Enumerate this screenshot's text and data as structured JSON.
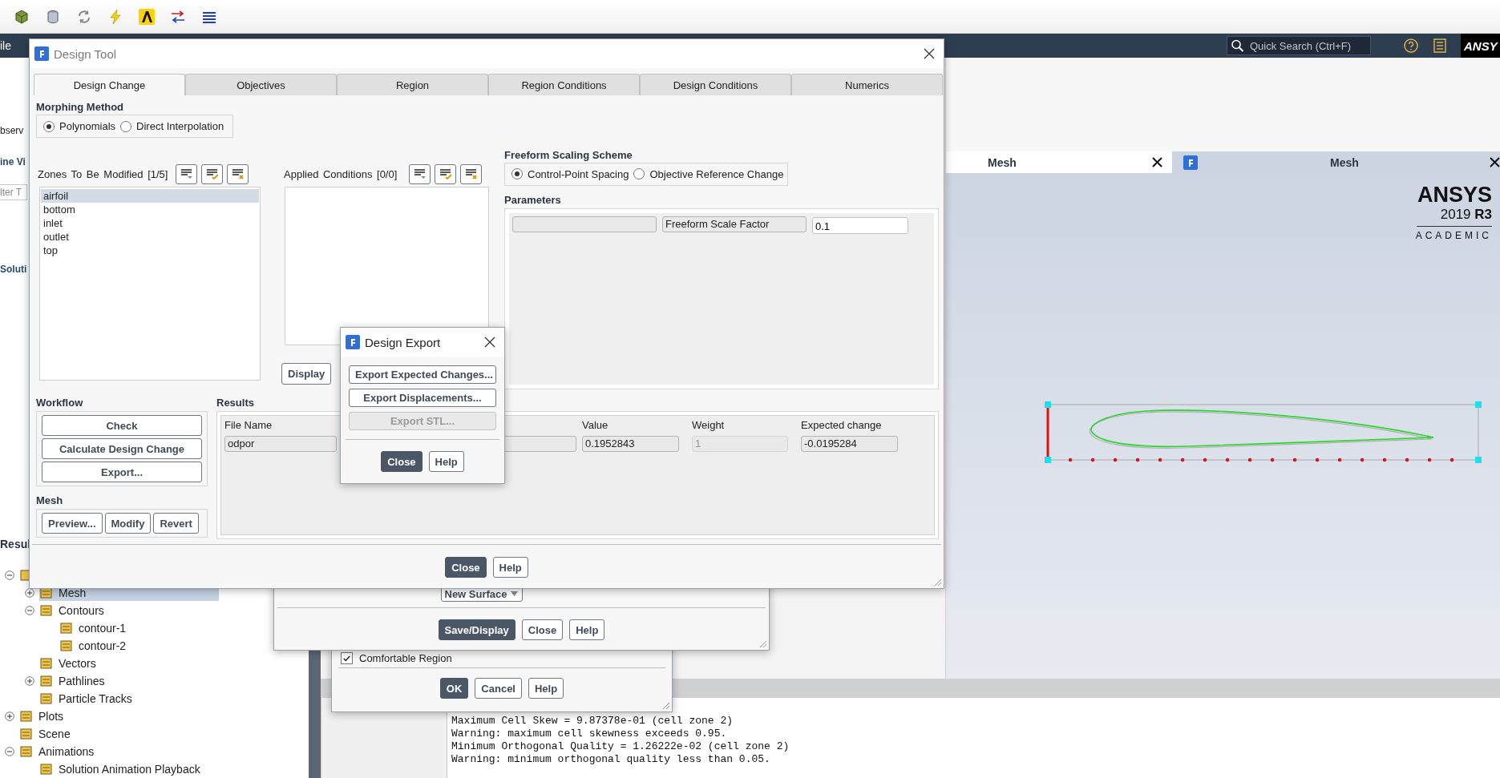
{
  "menu_bar": {
    "file_menu": "ile",
    "search": {
      "placeholder": "Quick Search (Ctrl+F)"
    },
    "logo": "ANSY"
  },
  "tree_panel": {
    "fragments": [
      {
        "kind": "label",
        "text": "bserv"
      },
      {
        "kind": "heading",
        "text": "ine Vi"
      },
      {
        "kind": "field",
        "placeholder": "lter T"
      },
      {
        "kind": "heading",
        "text": "Soluti"
      }
    ],
    "results_heading": "Resul",
    "tree": [
      {
        "expanded": true,
        "children": [
          {
            "label": "Mesh",
            "selected": true,
            "expanded": false
          },
          {
            "label": "Contours",
            "selected": false,
            "expanded": true,
            "children": [
              {
                "label": "contour-1",
                "selected": false
              },
              {
                "label": "contour-2",
                "selected": false
              }
            ]
          },
          {
            "label": "Vectors",
            "selected": false
          },
          {
            "label": "Pathlines",
            "selected": false,
            "expanded": false
          },
          {
            "label": "Particle Tracks",
            "selected": false
          }
        ]
      },
      {
        "label": "Plots",
        "selected": false,
        "expanded": false
      },
      {
        "label": "Scene",
        "selected": false
      },
      {
        "label": "Animations",
        "selected": false,
        "expanded": true,
        "children": [
          {
            "label": "Solution Animation Playback",
            "selected": false
          }
        ]
      }
    ]
  },
  "graphics": {
    "tabs": [
      {
        "label": "Mesh",
        "selected": true
      },
      {
        "label": "Mesh",
        "selected": false
      }
    ],
    "logo": {
      "name": "ANSYS",
      "version": "2019 **R3**",
      "edition": "ACADEMIC"
    }
  },
  "console": {
    "lines": [
      "Maximum Cell Skew = 9.87378e-01 (cell zone 2)",
      "Warning: maximum cell skewness exceeds 0.95.",
      "Minimum Orthogonal Quality = 1.26222e-02 (cell zone 2)",
      "Warning: minimum orthogonal quality less than 0.05."
    ]
  },
  "region_dialog": {
    "checkbox": {
      "label": "Comfortable Region",
      "checked": true
    },
    "buttons": [
      {
        "label": "OK",
        "primary": true
      },
      {
        "label": "Cancel",
        "primary": false
      },
      {
        "label": "Help",
        "primary": false
      }
    ]
  },
  "surface_dialog": {
    "dropdown": "New Surface",
    "buttons": [
      {
        "label": "Save/Display",
        "primary": true
      },
      {
        "label": "Close",
        "primary": false
      },
      {
        "label": "Help",
        "primary": false
      }
    ]
  },
  "design_tool": {
    "title": "Design Tool",
    "tabs": [
      {
        "label": "Design Change",
        "selected": true
      },
      {
        "label": "Objectives",
        "selected": false
      },
      {
        "label": "Region",
        "selected": false
      },
      {
        "label": "Region Conditions",
        "selected": false
      },
      {
        "label": "Design Conditions",
        "selected": false
      },
      {
        "label": "Numerics",
        "selected": false
      }
    ],
    "morphing_method": {
      "label": "Morphing Method",
      "options": [
        {
          "label": "Polynomials",
          "selected": true
        },
        {
          "label": "Direct Interpolation",
          "selected": false
        }
      ]
    },
    "zones": {
      "label": "Zones To Be Modified",
      "count": "[1/5]",
      "items": [
        {
          "label": "airfoil",
          "selected": true
        },
        {
          "label": "bottom",
          "selected": false
        },
        {
          "label": "inlet",
          "selected": false
        },
        {
          "label": "outlet",
          "selected": false
        },
        {
          "label": "top",
          "selected": false
        }
      ]
    },
    "applied_conditions": {
      "label": "Applied Conditions",
      "count": "[0/0]",
      "button": "Display"
    },
    "freeform_scaling": {
      "label": "Freeform Scaling Scheme",
      "options": [
        {
          "label": "Control-Point Spacing",
          "selected": true
        },
        {
          "label": "Objective Reference Change",
          "selected": false
        }
      ]
    },
    "parameters": {
      "label": "Parameters",
      "name": "Freeform Scale Factor",
      "value": "0.1"
    },
    "workflow": {
      "label": "Workflow",
      "buttons": [
        "Check",
        "Calculate Design Change",
        "Export..."
      ]
    },
    "mesh": {
      "label": "Mesh",
      "buttons": [
        "Preview...",
        "Modify",
        "Revert"
      ]
    },
    "results": {
      "label": "Results",
      "columns": [
        {
          "heading": "File Name",
          "cell": {
            "value": "odpor",
            "disabled": false
          }
        },
        {
          "cell": {
            "disabled": false
          }
        },
        {
          "heading": "Value",
          "cell": {
            "value": "0.1952843",
            "disabled": false
          }
        },
        {
          "heading": "Weight",
          "cell": {
            "value": "1",
            "disabled": true
          }
        },
        {
          "heading": "Expected change",
          "cell": {
            "value": "-0.0195284",
            "disabled": false
          }
        }
      ]
    },
    "footer_buttons": [
      {
        "label": "Close",
        "primary": true
      },
      {
        "label": "Help",
        "primary": false
      }
    ]
  },
  "design_export": {
    "title": "Design Export",
    "buttons": [
      {
        "label": "Export Expected Changes...",
        "disabled": false
      },
      {
        "label": "Export Displacements...",
        "disabled": false
      },
      {
        "label": "Export STL...",
        "disabled": true
      }
    ],
    "footer_buttons": [
      {
        "label": "Close",
        "primary": true
      },
      {
        "label": "Help",
        "primary": false
      }
    ]
  }
}
